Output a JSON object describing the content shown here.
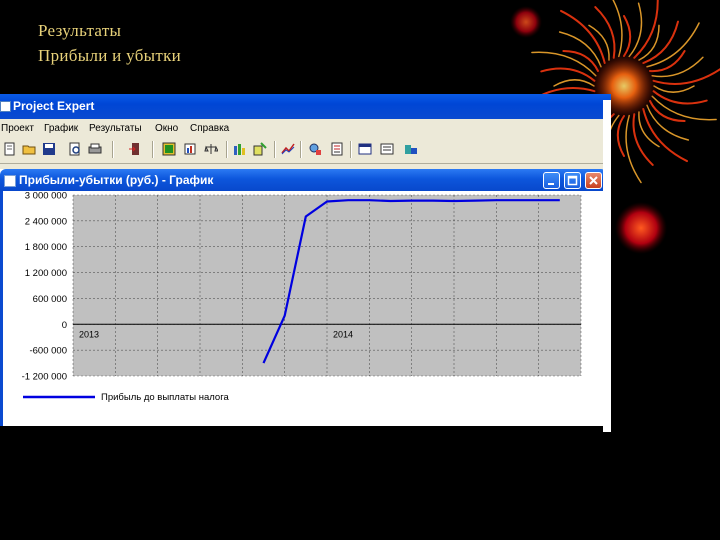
{
  "slide": {
    "title_line1": "Результаты",
    "title_line2": "Прибыли и убытки"
  },
  "app": {
    "title": "Project Expert",
    "menu": [
      "Проект",
      "График",
      "Результаты",
      "Окно",
      "Справка"
    ],
    "toolbar_icons": [
      "new-icon",
      "open-icon",
      "save-icon",
      "preview-icon",
      "print-icon",
      "export-icon",
      "table-icon",
      "chart-icon",
      "balance-icon",
      "report-icon",
      "pin-icon",
      "line-chart-icon",
      "analysis-icon",
      "report-list-icon",
      "list-icon",
      "notes-icon",
      "database-icon"
    ]
  },
  "document": {
    "title": "Прибыли-убытки (руб.) - График",
    "buttons": [
      "minimize",
      "maximize",
      "close"
    ]
  },
  "colors": {
    "accent_title": "#e8d27a",
    "series_line": "#0000e0",
    "plot_bg": "#c0c0c0",
    "titlebar": "#0a4ad0"
  },
  "chart_data": {
    "type": "line",
    "y_ticks": [
      "3 000 000",
      "2 400 000",
      "1 800 000",
      "1 200 000",
      "600 000",
      "0",
      "-600 000",
      "-1 200 000"
    ],
    "x_ticks": [
      "2013",
      "2014"
    ],
    "ylim": [
      -1200000,
      3000000
    ],
    "grid": true,
    "legend_position": "bottom",
    "series": [
      {
        "name": "Прибыль до выплаты налога",
        "points": [
          [
            "2013-10",
            -900000
          ],
          [
            "2013-11",
            200000
          ],
          [
            "2013-12",
            2500000
          ],
          [
            "2014-01",
            2850000
          ],
          [
            "2014-02",
            2880000
          ],
          [
            "2014-03",
            2880000
          ],
          [
            "2014-04",
            2860000
          ],
          [
            "2014-05",
            2870000
          ],
          [
            "2014-06",
            2870000
          ],
          [
            "2014-07",
            2860000
          ],
          [
            "2014-08",
            2870000
          ],
          [
            "2014-09",
            2880000
          ],
          [
            "2014-10",
            2880000
          ],
          [
            "2014-11",
            2880000
          ],
          [
            "2014-12",
            2880000
          ]
        ]
      }
    ]
  }
}
